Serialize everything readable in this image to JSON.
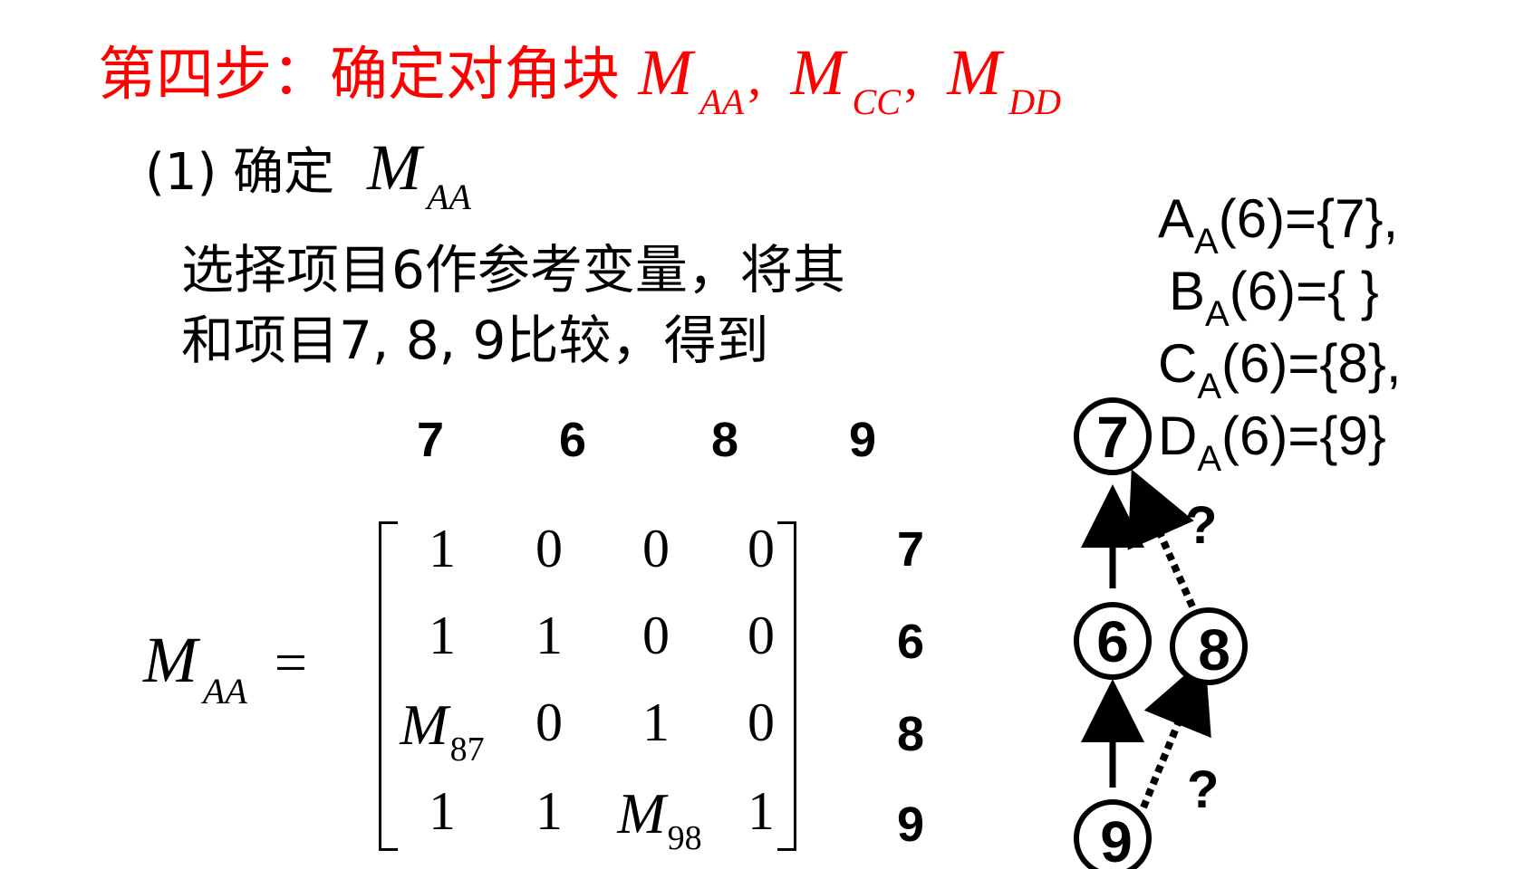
{
  "title": {
    "prefix": "第四步：确定对角块",
    "blocks": [
      {
        "m": "M",
        "sub": "AA",
        "sep": ","
      },
      {
        "m": "M",
        "sub": "CC",
        "sep": ","
      },
      {
        "m": "M",
        "sub": "DD",
        "sep": ""
      }
    ]
  },
  "step": {
    "label": "(1) 确定",
    "m": "M",
    "sub": "AA"
  },
  "description": {
    "line1": "选择项目6作参考变量，将其",
    "line2": "和项目7, 8, 9比较，得到"
  },
  "matrix": {
    "lhs_m": "M",
    "lhs_sub": "AA",
    "equals": "=",
    "col_headers": [
      "7",
      "6",
      "8",
      "9"
    ],
    "row_headers": [
      "7",
      "6",
      "8",
      "9"
    ],
    "rows": [
      [
        {
          "v": "1"
        },
        {
          "v": "0"
        },
        {
          "v": "0"
        },
        {
          "v": "0"
        }
      ],
      [
        {
          "v": "1"
        },
        {
          "v": "1"
        },
        {
          "v": "0"
        },
        {
          "v": "0"
        }
      ],
      [
        {
          "m": "M",
          "sub": "87"
        },
        {
          "v": "0"
        },
        {
          "v": "1"
        },
        {
          "v": "0"
        }
      ],
      [
        {
          "v": "1"
        },
        {
          "v": "1"
        },
        {
          "m": "M",
          "sub": "98"
        },
        {
          "v": "1"
        }
      ]
    ]
  },
  "sets": [
    {
      "letter": "A",
      "sub": "A",
      "rest": "(6)={7},"
    },
    {
      "letter": "B",
      "sub": "A",
      "rest": "(6)={   }"
    },
    {
      "letter": "C",
      "sub": "A",
      "rest": "(6)={8},"
    },
    {
      "letter": "D",
      "sub": "A",
      "rest": "(6)={9}"
    }
  ],
  "graph": {
    "nodes": [
      "7",
      "6",
      "8",
      "9"
    ],
    "question_mark": "?"
  }
}
